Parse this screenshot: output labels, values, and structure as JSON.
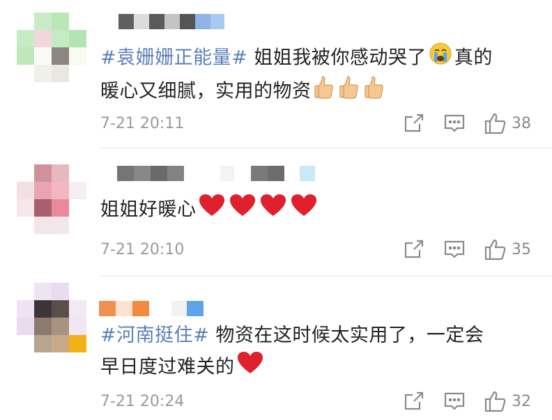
{
  "comments": [
    {
      "hashtag": "#袁姗姗正能量#",
      "text_line1": " 姐姐我被你感动哭了",
      "text_line1_after": "真的",
      "text_line2": "暖心又细腻，实用的物资",
      "timestamp": "7-21 20:11",
      "likes": "38"
    },
    {
      "hashtag": "",
      "text_line1": "姐姐好暖心",
      "timestamp": "7-21 20:10",
      "likes": "35"
    },
    {
      "hashtag": "#河南挺住#",
      "text_line1": " 物资在这时候太实用了，一定会",
      "text_line2": "早日度过难关的",
      "timestamp": "7-21 20:24",
      "likes": "32"
    }
  ],
  "icons": {
    "share": "share-icon",
    "comment": "comment-icon",
    "like": "thumbs-up-icon",
    "crying": "crying-face-emoji",
    "thumb": "thumbs-up-emoji",
    "heart": "red-heart-emoji"
  },
  "colors": {
    "hashtag": "#5b7fb9",
    "meta": "#9a9a9a",
    "heart": "#e0202c"
  }
}
